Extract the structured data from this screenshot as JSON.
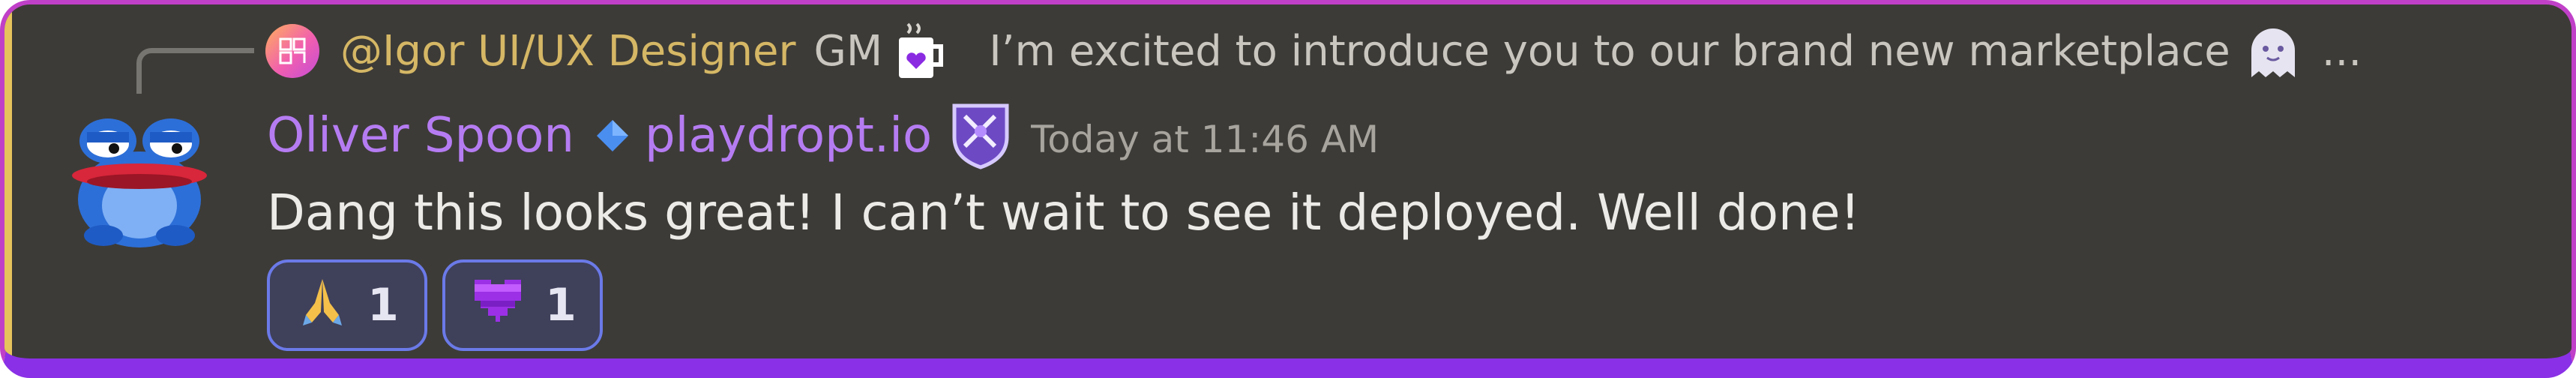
{
  "reply": {
    "username": "@Igor UI/UX Designer",
    "preview_start": "GM",
    "preview_text": "I’m excited to introduce you to our brand new marketplace",
    "ellipsis": "...",
    "avatar_initials": "卐"
  },
  "message": {
    "author": "Oliver Spoon",
    "server_tag": "playdropt.io",
    "timestamp": "Today at 11:46 AM",
    "text": "Dang this looks great! I can’t wait to see it deployed. Well done!"
  },
  "reactions": [
    {
      "emoji": "🙏",
      "icon": "praying-hands-icon",
      "count": "1"
    },
    {
      "emoji": "💜",
      "icon": "pixel-heart-icon",
      "count": "1"
    }
  ],
  "colors": {
    "background": "#3d3b37",
    "author": "#b57cf2",
    "reply_username": "#d5b765",
    "reaction_border": "#6b7ae8",
    "frame_top": "#c040c8",
    "frame_bottom": "#8a30e6"
  }
}
